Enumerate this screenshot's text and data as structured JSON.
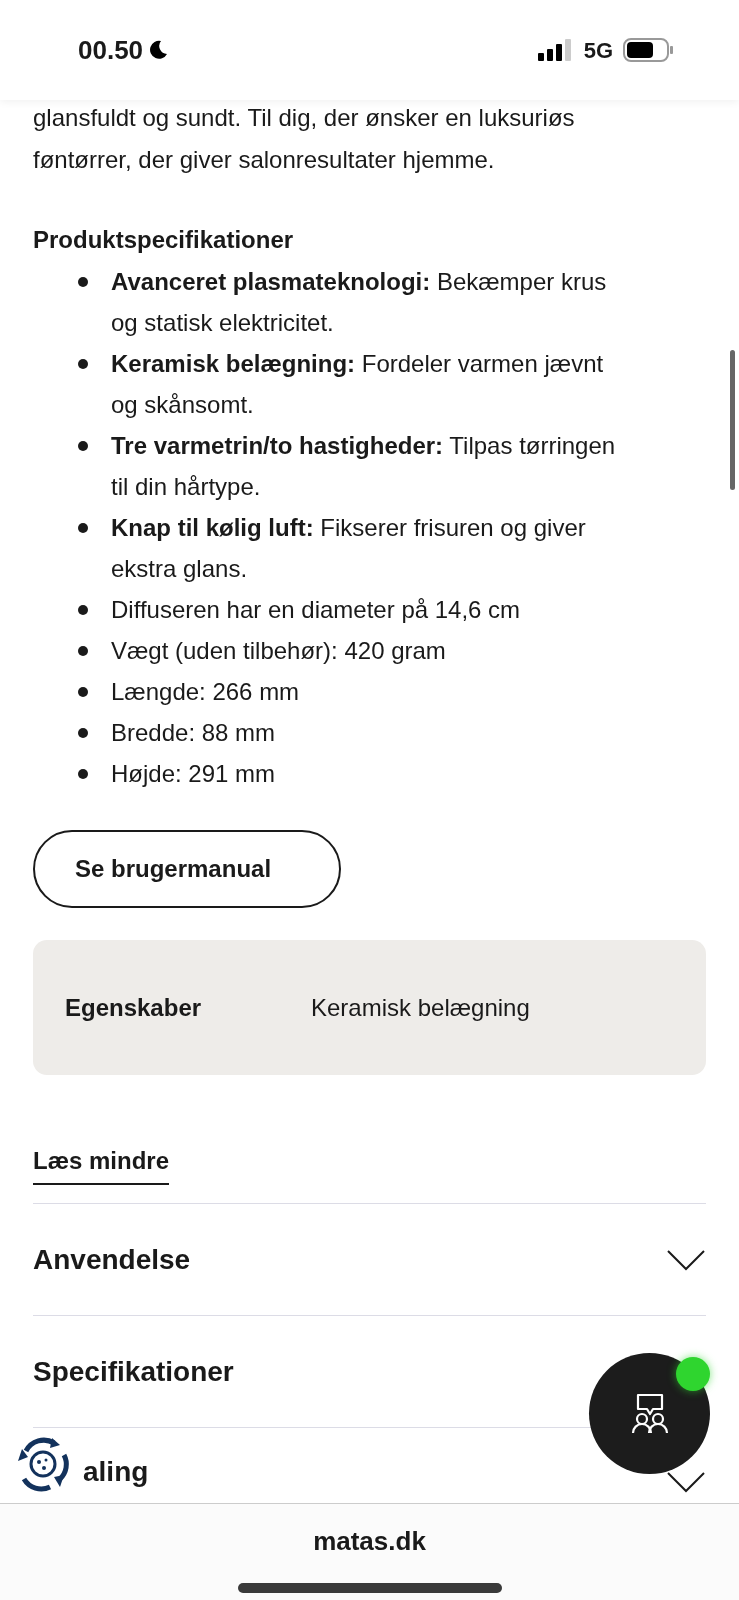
{
  "status_bar": {
    "time": "00.50",
    "network": "5G"
  },
  "description": "glansfuldt og sundt. Til dig, der ønsker en luksuriøs føntørrer, der giver salonresultater hjemme.",
  "spec_heading": "Produktspecifikationer",
  "spec_items": [
    "**Avanceret plasmateknologi:** Bekæmper krus og statisk elektricitet.",
    "**Keramisk belægning:** Fordeler varmen jævnt og skånsomt.",
    "**Tre varmetrin/to hastigheder:** Tilpas tørringen til din hårtype.",
    "**Knap til kølig luft:** Fikserer frisuren og giver ekstra glans.",
    "Diffuseren har en diameter på 14,6 cm",
    "Vægt (uden tilbehør): 420 gram",
    "Længde: 266 mm",
    "Bredde: 88 mm",
    "Højde: 291 mm"
  ],
  "manual_button": "Se brugermanual",
  "properties": [
    {
      "label": "Egenskaber",
      "value": "Keramisk belægning"
    }
  ],
  "read_less_link": "Læs mindre",
  "accordion": [
    {
      "title": "Anvendelse",
      "expanded": false
    },
    {
      "title": "Specifikationer",
      "expanded": false
    },
    {
      "title": "aling",
      "expanded": false
    }
  ],
  "chat_button": {
    "online": true
  },
  "address_bar": {
    "url": "matas.dk"
  }
}
